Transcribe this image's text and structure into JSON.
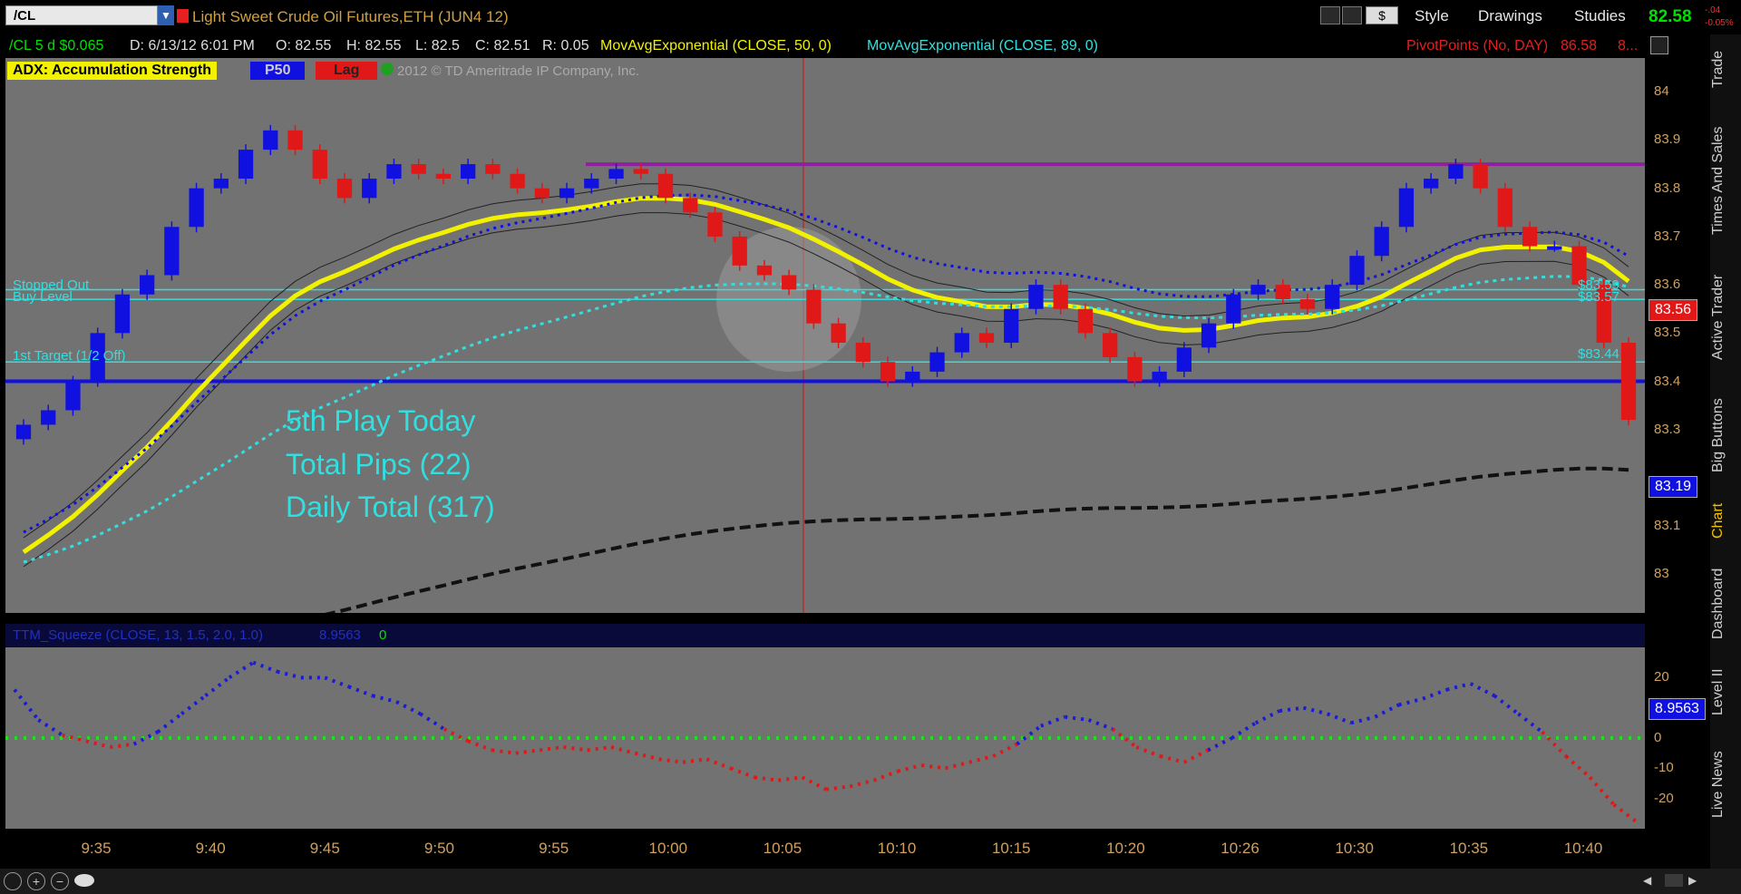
{
  "toolbar": {
    "symbol": "/CL",
    "title": "Light Sweet Crude Oil Futures,ETH (JUN4 12)",
    "currency_btn": "$",
    "style_label": "Style",
    "drawings_label": "Drawings",
    "studies_label": "Studies",
    "last_price": "82.58",
    "change_top": "-.04",
    "change_pct": "-0.05%"
  },
  "info": {
    "symbol_period": "/CL 5 d $0.065",
    "date": "D: 6/13/12 6:01 PM",
    "open": "O: 82.55",
    "high": "H: 82.55",
    "low": "L: 82.5",
    "close": "C: 82.51",
    "range": "R: 0.05",
    "ma50": "MovAvgExponential (CLOSE, 50, 0)",
    "ma89": "MovAvgExponential (CLOSE, 89, 0)",
    "pivot": "PivotPoints (No, DAY)",
    "pivot_val": "86.58",
    "pivot_more": "8..."
  },
  "study_labels": {
    "adx": "ADX:  Accumulation Strength",
    "p50": "P50",
    "lag": "Lag",
    "copyright": "2012 © TD Ameritrade IP Company, Inc."
  },
  "annotations": {
    "stopped_out": "Stopped Out",
    "buy_level": "Buy Level",
    "first_target": "1st Target (1/2 Off)",
    "play": "5th Play Today",
    "pips": "Total Pips (22)",
    "daily": "Daily Total (317)",
    "price_tag_1": "$83.59",
    "price_tag_2": "$83.57",
    "price_tag_3": "$83.44"
  },
  "lower_study": {
    "name": "TTM_Squeeze (CLOSE, 13, 1.5, 2.0, 1.0)",
    "value": "8.9563",
    "alert": "0"
  },
  "badges": {
    "current": "83.56",
    "level": "83.19",
    "squeeze": "8.9563"
  },
  "sidebar": [
    "Trade",
    "Times And Sales",
    "Active Trader",
    "Big Buttons",
    "Chart",
    "Dashboard",
    "Level II",
    "Live News"
  ],
  "colors": {
    "up": "#1010e0",
    "down": "#e01818",
    "ma50": "#f2f200",
    "ma89": "#30e0e0",
    "accent": "#00e000"
  },
  "chart_data": [
    {
      "type": "line",
      "title": "Light Sweet Crude Oil Futures,ETH (JUN4 12)",
      "x_ticks": [
        "9:35",
        "9:40",
        "9:45",
        "9:50",
        "9:55",
        "10:00",
        "10:05",
        "10:10",
        "10:15",
        "10:20",
        "10:26",
        "10:30",
        "10:35",
        "10:40"
      ],
      "y_ticks": [
        84,
        83.9,
        83.8,
        83.7,
        83.6,
        83.5,
        83.4,
        83.3,
        83.1,
        83
      ],
      "ylim": [
        82.92,
        84.07
      ],
      "horizontal_levels": {
        "stopped_out": 83.59,
        "buy_level": 83.57,
        "first_target": 83.44,
        "blue_level": 83.4,
        "pivot_purple": 83.85
      },
      "series": [
        {
          "values": [
            83.31,
            83.34,
            83.4,
            83.5,
            83.58,
            83.62,
            83.72,
            83.8,
            83.82,
            83.88,
            83.92,
            83.88,
            83.82,
            83.78,
            83.82,
            83.85,
            83.83,
            83.82,
            83.85,
            83.83,
            83.8,
            83.78,
            83.8,
            83.82,
            83.84,
            83.83,
            83.78,
            83.75,
            83.7,
            83.64,
            83.62,
            83.59,
            83.52,
            83.48,
            83.44,
            83.4,
            83.42,
            83.46,
            83.5,
            83.48,
            83.55,
            83.6,
            83.55,
            83.5,
            83.45,
            83.4,
            83.42,
            83.47,
            83.52,
            83.58,
            83.6,
            83.57,
            83.55,
            83.6,
            83.66,
            83.72,
            83.8,
            83.82,
            83.85,
            83.8,
            83.72,
            83.68,
            83.68,
            83.6,
            83.48,
            83.32
          ]
        }
      ]
    },
    {
      "type": "line",
      "title": "TTM_Squeeze (CLOSE, 13, 1.5, 2.0, 1.0)",
      "y_ticks": [
        20,
        10,
        0,
        -10,
        -20
      ],
      "ylim": [
        -30,
        30
      ],
      "series": [
        {
          "values": [
            16,
            6,
            1,
            -1,
            -3,
            -2,
            2,
            8,
            14,
            20,
            25,
            22,
            20,
            20,
            17,
            14,
            12,
            8,
            3,
            -1,
            -4,
            -5,
            -4,
            -3,
            -4,
            -3,
            -5,
            -7,
            -8,
            -7,
            -10,
            -13,
            -14,
            -13,
            -17,
            -16,
            -14,
            -11,
            -9,
            -10,
            -8,
            -6,
            -2,
            4,
            7,
            6,
            3,
            -3,
            -6,
            -8,
            -4,
            0,
            5,
            9,
            10,
            8,
            5,
            7,
            11,
            13,
            16,
            18,
            14,
            8,
            2,
            -6,
            -13,
            -22,
            -28
          ]
        }
      ]
    }
  ]
}
